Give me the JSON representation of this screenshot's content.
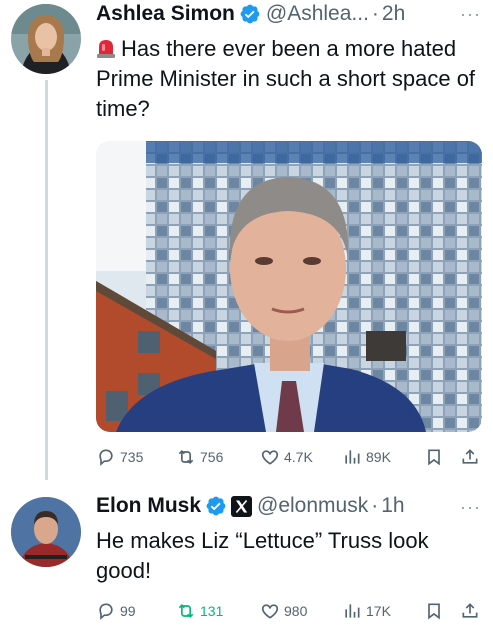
{
  "tweet1": {
    "name": "Ashlea Simon",
    "handle": "@Ashlea...",
    "time": "2h",
    "separator": "·",
    "more": "···",
    "text": "Has there ever been a more hated Prime Minister in such a short space of time?",
    "metrics": {
      "replies": "735",
      "reposts": "756",
      "likes": "4.7K",
      "views": "89K"
    }
  },
  "tweet2": {
    "name": "Elon Musk",
    "handle": "@elonmusk",
    "time": "1h",
    "separator": "·",
    "more": "···",
    "text": "He makes Liz “Lettuce” Truss look good!",
    "metrics": {
      "replies": "99",
      "reposts": "131",
      "likes": "980",
      "views": "17K"
    }
  },
  "colors": {
    "text": "#0f1419",
    "secondary": "#536471",
    "verified": "#1d9bf0",
    "repost_active": "#00ba7c",
    "thread_line": "#cfd9de"
  },
  "icons": [
    "verified-badge",
    "siren-emoji",
    "x-logo",
    "reply",
    "repost",
    "like",
    "views",
    "bookmark",
    "share"
  ]
}
